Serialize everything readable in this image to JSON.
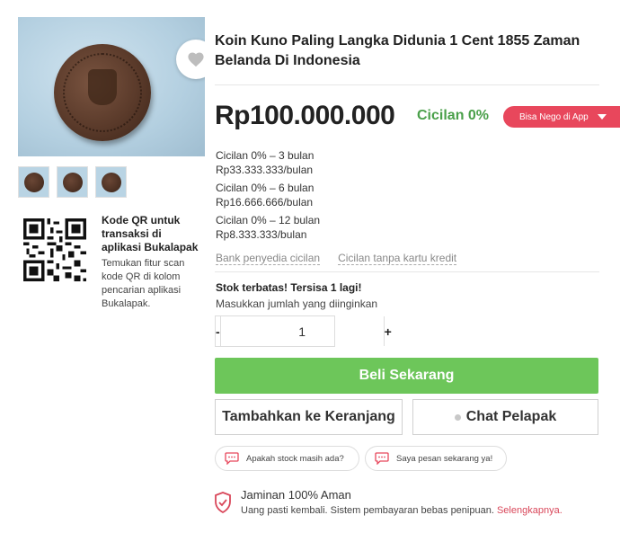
{
  "product": {
    "title": "Koin Kuno Paling Langka Didunia 1 Cent 1855 Zaman Belanda Di Indonesia",
    "price": "Rp100.000.000",
    "cicilan_badge": "Cicilan 0%",
    "nego_label": "Bisa Nego di App",
    "image_icon": "coin-photo",
    "thumbnail_count": 3
  },
  "installments": [
    {
      "plan": "Cicilan 0% – 3 bulan",
      "amount": "Rp33.333.333/bulan"
    },
    {
      "plan": "Cicilan 0% – 6 bulan",
      "amount": "Rp16.666.666/bulan"
    },
    {
      "plan": "Cicilan 0% – 12 bulan",
      "amount": "Rp8.333.333/bulan"
    }
  ],
  "links": {
    "bank": "Bank penyedia cicilan",
    "no_card": "Cicilan tanpa kartu kredit"
  },
  "qr": {
    "title": "Kode QR untuk transaksi di aplikasi Bukalapak",
    "description": "Temukan fitur scan kode QR di kolom pencarian aplikasi Bukalapak."
  },
  "stock": {
    "title": "Stok terbatas! Tersisa 1 lagi!",
    "subtitle": "Masukkan jumlah yang diinginkan"
  },
  "quantity": {
    "minus": "-",
    "value": "1",
    "plus": "+"
  },
  "buttons": {
    "buy": "Beli Sekarang",
    "cart": "Tambahkan ke Keranjang",
    "chat": "Chat Pelapak"
  },
  "quick_chat": [
    "Apakah stock masih ada?",
    "Saya pesan sekarang ya!"
  ],
  "guarantee": {
    "title": "Jaminan 100% Aman",
    "text": "Uang pasti kembali. Sistem pembayaran bebas penipuan.",
    "link": "Selengkapnya."
  },
  "colors": {
    "accent_red": "#e8475c",
    "buy_green": "#6dc65a",
    "cicilan_green": "#4aa04a",
    "link_red": "#d9475a"
  }
}
